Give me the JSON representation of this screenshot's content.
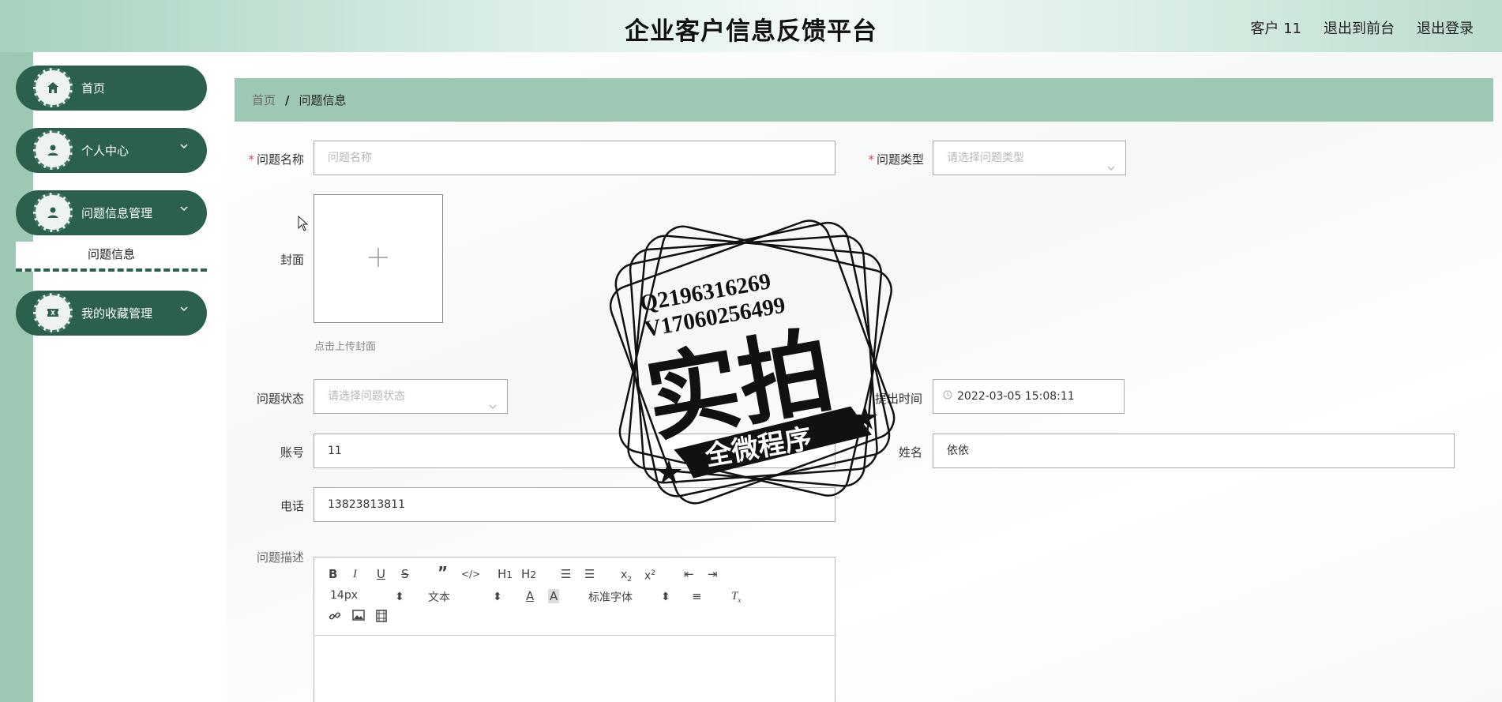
{
  "header": {
    "title": "企业客户信息反馈平台",
    "user_label": "客户 11",
    "front_link": "退出到前台",
    "logout_link": "退出登录"
  },
  "sidebar": {
    "items": [
      {
        "label": "首页",
        "icon": "home-icon"
      },
      {
        "label": "个人中心",
        "icon": "user-icon"
      },
      {
        "label": "问题信息管理",
        "icon": "user-icon"
      },
      {
        "label": "我的收藏管理",
        "icon": "ticket-icon"
      }
    ],
    "sub_item": "问题信息",
    "accent": "#2b614c"
  },
  "breadcrumb": {
    "home": "首页",
    "separator": "/",
    "current": "问题信息"
  },
  "form": {
    "name_label": "问题名称",
    "name_placeholder": "问题名称",
    "type_label": "问题类型",
    "type_placeholder": "请选择问题类型",
    "cover_label": "封面",
    "cover_hint": "点击上传封面",
    "status_label": "问题状态",
    "status_placeholder": "请选择问题状态",
    "time_label": "提出时间",
    "time_value": "2022-03-05 15:08:11",
    "account_label": "账号",
    "account_value": "11",
    "person_label": "姓名",
    "person_value": "依依",
    "phone_label": "电话",
    "phone_value": "13823813811",
    "desc_label": "问题描述"
  },
  "editor": {
    "font_size": "14px",
    "block_type": "文本",
    "font_family": "标准字体"
  },
  "stamp": {
    "line1": "Q2196316269",
    "line2": "V17060256499",
    "big": "实拍",
    "banner": "全微程序"
  }
}
